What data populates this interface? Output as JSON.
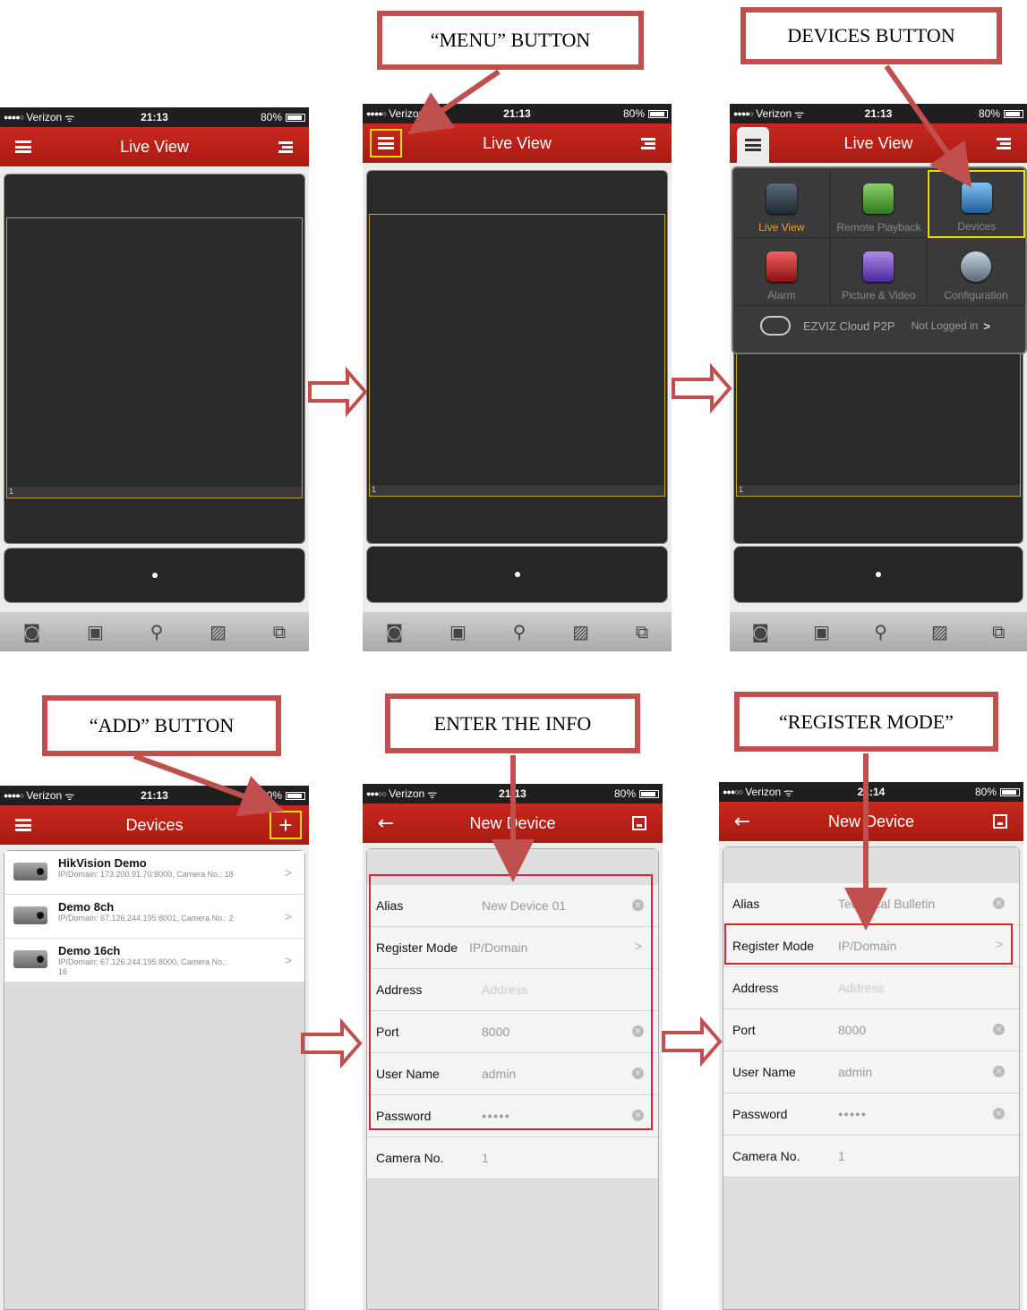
{
  "status": {
    "carrier": "Verizon",
    "battery": "80%",
    "time_a": "21:13",
    "time_b": "21:14"
  },
  "live": {
    "title": "Live View",
    "channel": "1"
  },
  "menu": {
    "items": [
      "Live View",
      "Remote Playback",
      "Devices",
      "Alarm",
      "Picture & Video",
      "Configuration"
    ],
    "cloud_label": "EZVIZ Cloud P2P",
    "cloud_status": "Not Logged in"
  },
  "devices": {
    "title": "Devices",
    "items": [
      {
        "name": "HikVision Demo",
        "sub": "IP/Domain: 173.200.91.70:8000, Camera No.: 18"
      },
      {
        "name": "Demo 8ch",
        "sub": "IP/Domain: 67.126.244.195:8001, Camera No.: 2"
      },
      {
        "name": "Demo 16ch",
        "sub": "IP/Domain: 67.126.244.195:8000, Camera No.: 16"
      }
    ]
  },
  "form": {
    "title": "New Device",
    "labels": {
      "alias": "Alias",
      "register_mode": "Register Mode",
      "address": "Address",
      "port": "Port",
      "user": "User Name",
      "password": "Password",
      "camera": "Camera No."
    },
    "values_a": {
      "alias": "New Device 01",
      "register_mode": "IP/Domain",
      "address_placeholder": "Address",
      "port": "8000",
      "user": "admin",
      "password": "●●●●●",
      "camera": "1"
    },
    "values_b": {
      "alias": "Technical Bulletin",
      "register_mode": "IP/Domain",
      "address_placeholder": "Address",
      "port": "8000",
      "user": "admin",
      "password": "●●●●●",
      "camera": "1"
    }
  },
  "callouts": {
    "menu": "“MENU” BUTTON",
    "devices": "DEVICES BUTTON",
    "add": "“ADD” BUTTON",
    "enter": "ENTER THE INFO",
    "register": "“REGISTER MODE”"
  },
  "colors": {
    "navbar": "#b8221a",
    "callout_border": "#c0504d",
    "highlight": "#f5d800",
    "form_highlight": "#e0202a"
  },
  "icons": {
    "menu": "hamburger-icon",
    "list": "list-icon",
    "add": "plus-icon",
    "back": "back-arrow-icon",
    "save": "save-icon"
  }
}
